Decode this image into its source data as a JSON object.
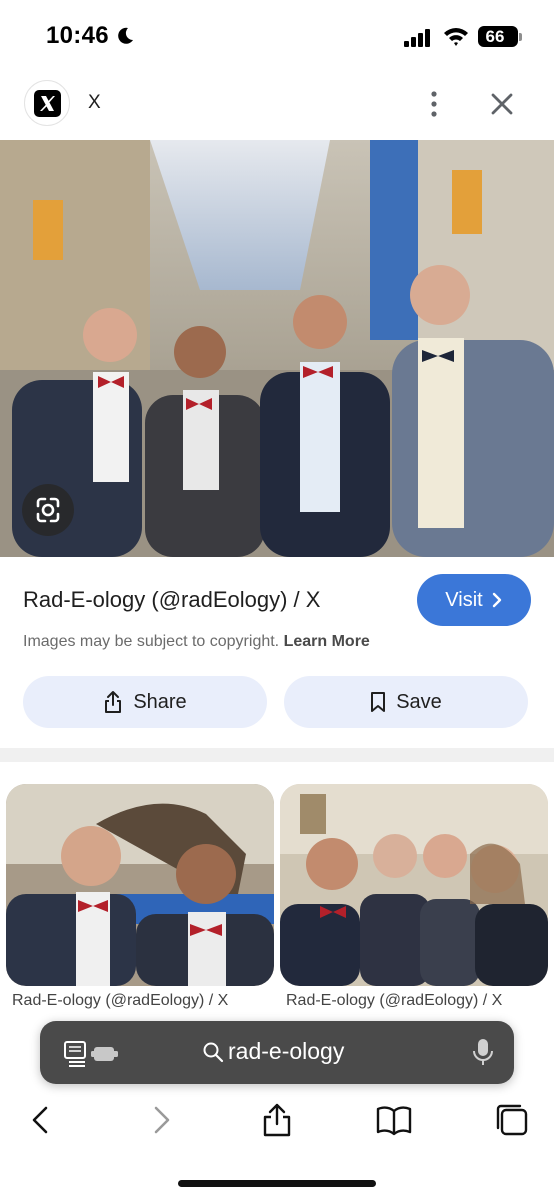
{
  "status_bar": {
    "time": "10:46",
    "battery": "66",
    "icons": [
      "moon-icon",
      "cellular-signal-icon",
      "wifi-icon",
      "battery-icon"
    ]
  },
  "header": {
    "site_name": "X",
    "icons": [
      "x-logo-icon",
      "more-vertical-icon",
      "close-icon"
    ]
  },
  "main_image": {
    "description_icon": "lens-icon"
  },
  "result": {
    "title": "Rad-E-ology (@radEology) / X",
    "visit_label": "Visit",
    "copyright_text": "Images may be subject to copyright.",
    "learn_more": "Learn More",
    "share_label": "Share",
    "save_label": "Save"
  },
  "related": [
    {
      "caption": "Rad-E-ology (@radEology) / X"
    },
    {
      "caption": "Rad-E-ology (@radEology) / X"
    }
  ],
  "browser": {
    "address": "rad-e-ology",
    "icons": [
      "back-icon",
      "forward-icon",
      "share-icon",
      "bookmarks-icon",
      "tabs-icon"
    ]
  },
  "colors": {
    "accent": "#3b77d8",
    "action_bg": "#e9eefb",
    "address_bar_bg": "#4a4a4a"
  }
}
